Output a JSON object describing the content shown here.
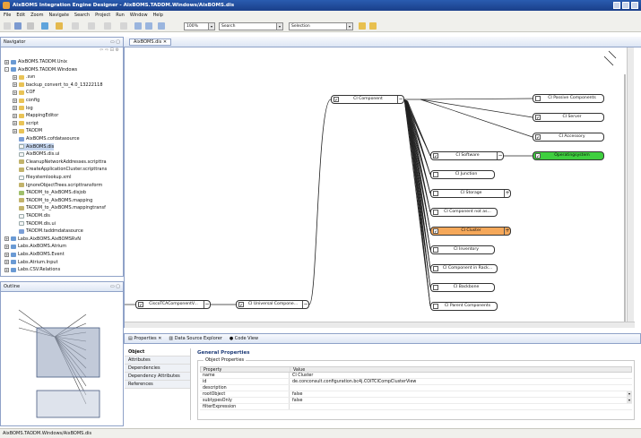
{
  "window": {
    "title": "AixBOMS Integration Engine Designer - AixBOMS.TADDM.Windows/AixBOMS.dis"
  },
  "menu": [
    "File",
    "Edit",
    "Zoom",
    "Navigate",
    "Search",
    "Project",
    "Run",
    "Window",
    "Help"
  ],
  "toolbar": {
    "zoom_value": "100%",
    "search_value": "Search",
    "selection_value": "Selection"
  },
  "navigator": {
    "tab_label": "Navigator",
    "items": [
      {
        "label": "AixBOMS.TADDM.Unix",
        "icon": "project-icon",
        "expander": "+"
      },
      {
        "label": "AixBOMS.TADDM.Windows",
        "icon": "project-icon",
        "expander": "-"
      },
      {
        "label": ".svn",
        "icon": "folder-icon",
        "expander": "+"
      },
      {
        "label": "backup_convert_to_4.0_13222118",
        "icon": "folder-icon",
        "expander": "+"
      },
      {
        "label": "COF",
        "icon": "folder-icon",
        "expander": "+"
      },
      {
        "label": "config",
        "icon": "folder-icon",
        "expander": "+"
      },
      {
        "label": "log",
        "icon": "folder-icon",
        "expander": "+"
      },
      {
        "label": "MappingEditor",
        "icon": "folder-icon",
        "expander": "+"
      },
      {
        "label": "script",
        "icon": "folder-icon",
        "expander": "+"
      },
      {
        "label": "TADDM",
        "icon": "folder-icon",
        "expander": "+"
      },
      {
        "label": "AixBOMS.cofdatasource",
        "icon": "datasource-icon",
        "expander": ""
      },
      {
        "label": "AixBOMS.dis",
        "icon": "file-icon",
        "expander": ""
      },
      {
        "label": "AixBOMS.dis.ui",
        "icon": "file-icon",
        "expander": ""
      },
      {
        "label": "CleanupNetworkAddresses.scripttra",
        "icon": "gear-icon",
        "expander": ""
      },
      {
        "label": "CreateApplicationCluster.scripttrans",
        "icon": "gear-icon",
        "expander": ""
      },
      {
        "label": "fileystemlookup.xml",
        "icon": "file-icon",
        "expander": ""
      },
      {
        "label": "IgnoreObjectTrees.scripttransform",
        "icon": "gear-icon",
        "expander": ""
      },
      {
        "label": "TADDM_to_AixBOMS.disjob",
        "icon": "job-icon",
        "expander": ""
      },
      {
        "label": "TADDM_to_AixBOMS.mapping",
        "icon": "gear-icon",
        "expander": ""
      },
      {
        "label": "TADDM_to_AixBOMS.mappingtransf",
        "icon": "gear-icon",
        "expander": ""
      },
      {
        "label": "TADDM.dis",
        "icon": "file-icon",
        "expander": ""
      },
      {
        "label": "TADDM.dis.ui",
        "icon": "file-icon",
        "expander": ""
      },
      {
        "label": "TADDM.taddmdatasource",
        "icon": "datasource-icon",
        "expander": ""
      },
      {
        "label": "Labs.AixBOMS.AixBOMSRvN",
        "icon": "project-icon",
        "expander": "+"
      },
      {
        "label": "Labs.AixBOMS.Atrium",
        "icon": "project-icon",
        "expander": "+"
      },
      {
        "label": "Labs.AixBOMS.Event",
        "icon": "project-icon",
        "expander": "+"
      },
      {
        "label": "Labs.Atrium.Input",
        "icon": "project-icon",
        "expander": "+"
      },
      {
        "label": "Labs.CSV.Relations",
        "icon": "project-icon",
        "expander": "+"
      }
    ]
  },
  "outline": {
    "tab_label": "Outline"
  },
  "editor": {
    "tab_label": "AixBOMS.dis",
    "nodes": [
      {
        "id": "cisco",
        "label": "CiscoTCAComponentV...",
        "checked": "✔",
        "expander": "−",
        "style": "normal"
      },
      {
        "id": "universal",
        "label": "CI Universal Compone...",
        "checked": "✔",
        "expander": "−",
        "style": "normal"
      },
      {
        "id": "component",
        "label": "CI Component",
        "checked": "✔",
        "expander": "−",
        "style": "normal"
      },
      {
        "id": "passive",
        "label": "CI Passive Components",
        "checked": "",
        "expander": "",
        "style": "normal"
      },
      {
        "id": "server",
        "label": "CI Server",
        "checked": "✔",
        "expander": "",
        "style": "normal"
      },
      {
        "id": "accessory",
        "label": "CI Accessory",
        "checked": "✔",
        "expander": "",
        "style": "normal"
      },
      {
        "id": "software",
        "label": "CI Software",
        "checked": "✔",
        "expander": "−",
        "style": "normal"
      },
      {
        "id": "os",
        "label": "Operatingsystem",
        "checked": "✔",
        "expander": "",
        "style": "green"
      },
      {
        "id": "junction",
        "label": "CI Junction",
        "checked": "",
        "expander": "",
        "style": "normal"
      },
      {
        "id": "storage",
        "label": "CI Storage",
        "checked": "",
        "expander": "+",
        "style": "normal"
      },
      {
        "id": "notas",
        "label": "CI Component not as...",
        "checked": "",
        "expander": "",
        "style": "normal"
      },
      {
        "id": "cluster",
        "label": "CI Cluster",
        "checked": "✔",
        "expander": "+",
        "style": "orange"
      },
      {
        "id": "inventory",
        "label": "CI Inventory",
        "checked": "",
        "expander": "",
        "style": "normal"
      },
      {
        "id": "inrack",
        "label": "CI Component in Rack...",
        "checked": "",
        "expander": "",
        "style": "normal"
      },
      {
        "id": "backbone",
        "label": "CI Backbone",
        "checked": "",
        "expander": "",
        "style": "normal"
      },
      {
        "id": "parent",
        "label": "CI Parent Components",
        "checked": "",
        "expander": "",
        "style": "normal"
      }
    ]
  },
  "bottom_tabs": [
    "Properties",
    "Data Source Explorer",
    "Code View"
  ],
  "properties": {
    "side_items": [
      "Object",
      "Attributes",
      "Dependencies",
      "Dependency Attributes",
      "References"
    ],
    "section_title": "General Properties",
    "group_label": "Object Properties",
    "header": [
      "Property",
      "Value"
    ],
    "rows": [
      {
        "property": "name",
        "value": "CI Cluster",
        "dropdown": ""
      },
      {
        "property": "id",
        "value": "de.conconsult.configuration.bc4j.COITCICompClusterView",
        "dropdown": ""
      },
      {
        "property": "description",
        "value": "",
        "dropdown": ""
      },
      {
        "property": "rootObject",
        "value": "false",
        "dropdown": "▾"
      },
      {
        "property": "subtypesOnly",
        "value": "false",
        "dropdown": "▾"
      },
      {
        "property": "filterExpression",
        "value": "",
        "dropdown": ""
      }
    ]
  },
  "status": {
    "path": "AixBOMS.TADDM.Windows/AixBOMS.dis"
  },
  "colors": {
    "title_bar": "#1a3f8a",
    "selected_node_green": "#3fcf3f",
    "selected_node_orange": "#f5a85a"
  }
}
